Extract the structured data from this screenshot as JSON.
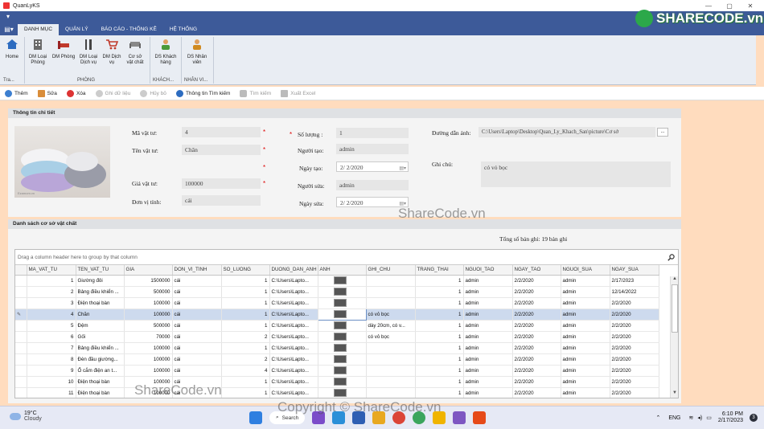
{
  "window": {
    "title": "QuanLyKS",
    "controls": [
      "—",
      "▢",
      "✕"
    ]
  },
  "ribbon": {
    "tabs": [
      "DANH MỤC",
      "QUẢN LÝ",
      "BÁO CÁO - THỐNG KÊ",
      "HỆ THỐNG"
    ],
    "active_tab": "DANH MỤC",
    "buttons": [
      {
        "label": "Home",
        "icon": "home-icon"
      },
      {
        "label": "DM Loại\nPhòng",
        "icon": "building-icon"
      },
      {
        "label": "DM Phòng",
        "icon": "bed-icon"
      },
      {
        "label": "DM Loại\nDịch vụ",
        "icon": "cutlery-icon"
      },
      {
        "label": "DM Dịch\nvụ",
        "icon": "cart-icon"
      },
      {
        "label": "Cơ sở\nvật chất",
        "icon": "sofa-icon"
      },
      {
        "label": "DS Khách\nhàng",
        "icon": "customer-icon"
      },
      {
        "label": "DS Nhân\nviên",
        "icon": "staff-icon"
      }
    ],
    "groups": [
      "Tra...",
      "PHÒNG",
      "KHÁCH...",
      "NHÂN VI..."
    ]
  },
  "toolbar": [
    {
      "label": "Thêm",
      "icon": "add-icon",
      "enabled": true
    },
    {
      "label": "Sửa",
      "icon": "edit-icon",
      "enabled": true
    },
    {
      "label": "Xóa",
      "icon": "delete-icon",
      "enabled": true
    },
    {
      "label": "Ghi dữ liệu",
      "icon": "save-icon",
      "enabled": false
    },
    {
      "label": "Hủy bỏ",
      "icon": "undo-icon",
      "enabled": false
    },
    {
      "label": "Thông tin Tìm kiếm",
      "icon": "info-icon",
      "enabled": true
    },
    {
      "label": "Tìm kiếm",
      "icon": "binoculars-icon",
      "enabled": false
    },
    {
      "label": "Xuất Excel",
      "icon": "excel-icon",
      "enabled": false
    }
  ],
  "detail": {
    "header": "Thông tin chi tiết",
    "ma_vat_tu_label": "Mã vật tư:",
    "ma_vat_tu": "4",
    "ten_vat_tu_label": "Tên vật tư:",
    "ten_vat_tu": "Chăn",
    "gia_vat_tu_label": "Giá vật tư:",
    "gia_vat_tu": "100000",
    "don_vi_tinh_label": "Đơn vị tính:",
    "don_vi_tinh": "cái",
    "so_luong_label": "Số lượng :",
    "so_luong": "1",
    "nguoi_tao_label": "Người tạo:",
    "nguoi_tao": "admin",
    "ngay_tao_label": "Ngày tạo:",
    "ngay_tao": "2/  2/2020",
    "nguoi_sua_label": "Người sửa:",
    "nguoi_sua": "admin",
    "ngay_sua_label": "Ngày sửa:",
    "ngay_sua": "2/  2/2020",
    "duong_dan_anh_label": "Đường dẫn ảnh:",
    "duong_dan_anh": "C:\\Users\\Laptop\\Desktop\\Quan_Ly_Khach_San\\picture\\Cơ sở",
    "ghi_chu_label": "Ghi chú:",
    "ghi_chu": "có vỏ bọc",
    "browse": "...",
    "required_mark": "*",
    "image_caption": "Ezamom.vn"
  },
  "list": {
    "header": "Danh sách cơ sở vật chất",
    "total": "Tổng số bản ghi: 19 bản ghi",
    "group_hint": "Drag a column header here to group by that column",
    "columns": [
      "MA_VAT_TU",
      "TEN_VAT_TU",
      "GIA",
      "DON_VI_TINH",
      "SO_LUONG",
      "DUONG_DAN_ANH",
      "ANH",
      "GHI_CHU",
      "TRANG_THAI",
      "NGUOI_TAO",
      "NGAY_TAO",
      "NGUOI_SUA",
      "NGAY_SUA"
    ],
    "selected_row": 3,
    "rows": [
      [
        "1",
        "Giường đôi",
        "1500000",
        "cái",
        "1",
        "C:\\Users\\Lapto...",
        "",
        "",
        "1",
        "admin",
        "2/2/2020",
        "admin",
        "2/17/2023"
      ],
      [
        "2",
        "Bảng điều khiển ...",
        "500000",
        "cái",
        "1",
        "C:\\Users\\Lapto...",
        "",
        "",
        "1",
        "admin",
        "2/2/2020",
        "admin",
        "12/14/2022"
      ],
      [
        "3",
        "Điện thoại bàn",
        "100000",
        "cái",
        "1",
        "C:\\Users\\Lapto...",
        "",
        "",
        "1",
        "admin",
        "2/2/2020",
        "admin",
        "2/2/2020"
      ],
      [
        "4",
        "Chăn",
        "100000",
        "cái",
        "1",
        "C:\\Users\\Lapto...",
        "",
        "có vỏ bọc",
        "1",
        "admin",
        "2/2/2020",
        "admin",
        "2/2/2020"
      ],
      [
        "5",
        "Đệm",
        "500000",
        "cái",
        "1",
        "C:\\Users\\Lapto...",
        "",
        "dày 20cm, có v...",
        "1",
        "admin",
        "2/2/2020",
        "admin",
        "2/2/2020"
      ],
      [
        "6",
        "Gối",
        "70000",
        "cái",
        "2",
        "C:\\Users\\Lapto...",
        "",
        "có vỏ bọc",
        "1",
        "admin",
        "2/2/2020",
        "admin",
        "2/2/2020"
      ],
      [
        "7",
        "Bảng điều khiển ...",
        "100000",
        "cái",
        "1",
        "C:\\Users\\Lapto...",
        "",
        "",
        "1",
        "admin",
        "2/2/2020",
        "admin",
        "2/2/2020"
      ],
      [
        "8",
        "Đèn đầu giường...",
        "100000",
        "cái",
        "2",
        "C:\\Users\\Lapto...",
        "",
        "",
        "1",
        "admin",
        "2/2/2020",
        "admin",
        "2/2/2020"
      ],
      [
        "9",
        "Ổ cắm  điện an t...",
        "100000",
        "cái",
        "4",
        "C:\\Users\\Lapto...",
        "",
        "",
        "1",
        "admin",
        "2/2/2020",
        "admin",
        "2/2/2020"
      ],
      [
        "10",
        "Điện thoại bàn",
        "100000",
        "cái",
        "1",
        "C:\\Users\\Lapto...",
        "",
        "",
        "1",
        "admin",
        "2/2/2020",
        "admin",
        "2/2/2020"
      ],
      [
        "11",
        "Điện thoại bàn",
        "100000",
        "cái",
        "1",
        "C:\\Users\\Lapto...",
        "",
        "",
        "1",
        "admin",
        "2/2/2020",
        "admin",
        "2/2/2020"
      ]
    ]
  },
  "taskbar": {
    "weather_temp": "19°C",
    "weather_desc": "Cloudy",
    "search": "Search",
    "lang": "ENG",
    "time": "6:10 PM",
    "date": "2/17/2023",
    "notifications": "3"
  },
  "watermarks": {
    "logo": "SHARECODE.vn",
    "mid": "ShareCode.vn",
    "bottom_left": "ShareCode.vn",
    "copyright": "Copyright © ShareCode.vn"
  },
  "colors": {
    "ribbon": "#3d5a99",
    "background": "#ffdcbe",
    "selected_row": "#cddaee",
    "required": "#dd0000"
  }
}
